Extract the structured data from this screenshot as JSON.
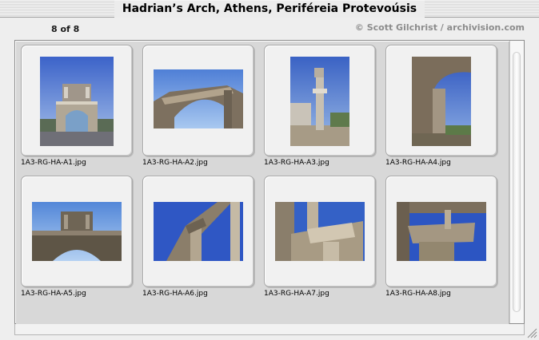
{
  "window": {
    "title": "Hadrian’s Arch, Athens, Periféreia Protevoúsis"
  },
  "header": {
    "counter": "8 of 8",
    "credit": "© Scott Gilchrist / archivision.com"
  },
  "thumbnails": [
    {
      "filename": "1A3-RG-HA-A1.jpg"
    },
    {
      "filename": "1A3-RG-HA-A2.jpg"
    },
    {
      "filename": "1A3-RG-HA-A3.jpg"
    },
    {
      "filename": "1A3-RG-HA-A4.jpg"
    },
    {
      "filename": "1A3-RG-HA-A5.jpg"
    },
    {
      "filename": "1A3-RG-HA-A6.jpg"
    },
    {
      "filename": "1A3-RG-HA-A7.jpg"
    },
    {
      "filename": "1A3-RG-HA-A8.jpg"
    }
  ],
  "colors": {
    "sky": "#3f66c8",
    "stone": "#8f8272",
    "slide": "#f1f1f1",
    "grid": "#d8d8d8"
  }
}
